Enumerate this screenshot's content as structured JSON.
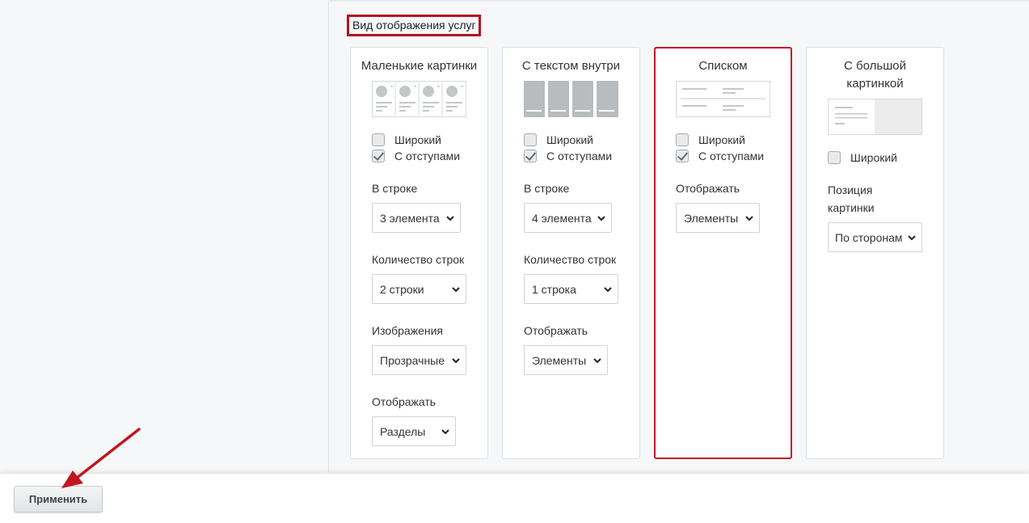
{
  "section": {
    "title": "Вид отображения услуг"
  },
  "colors": {
    "accent": "#c0162b",
    "arrow": "#c11620"
  },
  "cards": [
    {
      "title": "Маленькие картинки",
      "preview_icon": "small-pictures-preview-icon",
      "checkboxes": [
        {
          "label": "Широкий",
          "checked": false
        },
        {
          "label": "С отступами",
          "checked": true
        }
      ],
      "fields": [
        {
          "label": "В строке",
          "value": "3 элемента"
        },
        {
          "label": "Количество строк",
          "value": "2 строки"
        },
        {
          "label": "Изображения",
          "value": "Прозрачные"
        },
        {
          "label": "Отображать",
          "value": "Разделы"
        }
      ]
    },
    {
      "title": "С текстом внутри",
      "preview_icon": "text-inside-preview-icon",
      "checkboxes": [
        {
          "label": "Широкий",
          "checked": false
        },
        {
          "label": "С отступами",
          "checked": true
        }
      ],
      "fields": [
        {
          "label": "В строке",
          "value": "4 элемента"
        },
        {
          "label": "Количество строк",
          "value": "1 строка"
        },
        {
          "label": "Отображать",
          "value": "Элементы"
        }
      ]
    },
    {
      "title": "Списком",
      "selected": true,
      "preview_icon": "list-preview-icon",
      "checkboxes": [
        {
          "label": "Широкий",
          "checked": false
        },
        {
          "label": "С отступами",
          "checked": true
        }
      ],
      "fields": [
        {
          "label": "Отображать",
          "value": "Элементы"
        }
      ]
    },
    {
      "title": "С большой картинкой",
      "preview_icon": "big-picture-preview-icon",
      "checkboxes": [
        {
          "label": "Широкий",
          "checked": false
        }
      ],
      "fields": [
        {
          "label": "Позиция картинки",
          "value": "По сторонам"
        }
      ]
    }
  ],
  "footer": {
    "apply_label": "Применить"
  }
}
